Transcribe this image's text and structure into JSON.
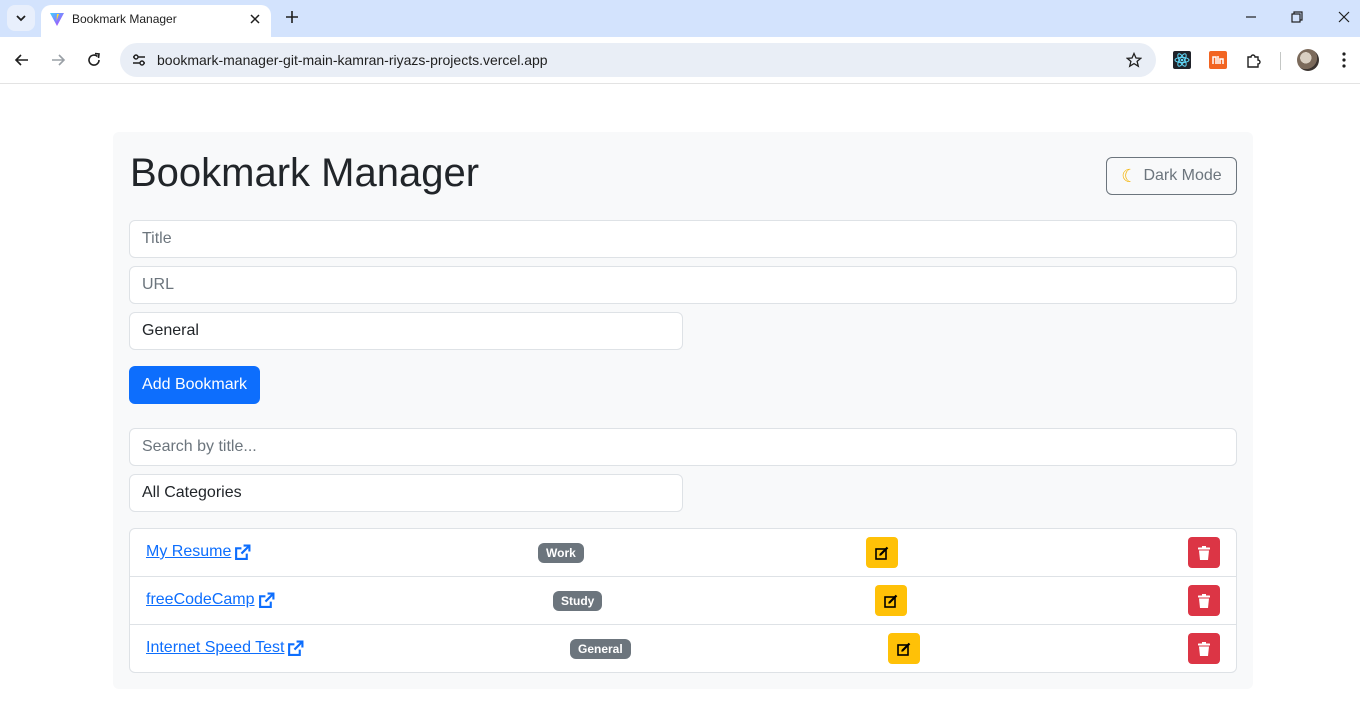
{
  "browser": {
    "tab_title": "Bookmark Manager",
    "url": "bookmark-manager-git-main-kamran-riyazs-projects.vercel.app"
  },
  "page": {
    "title": "Bookmark Manager",
    "dark_mode_label": "Dark Mode",
    "title_placeholder": "Title",
    "url_placeholder": "URL",
    "category_value": "General",
    "add_button": "Add Bookmark",
    "search_placeholder": "Search by title...",
    "filter_value": "All Categories"
  },
  "bookmarks": [
    {
      "title": "My Resume",
      "category": "Work"
    },
    {
      "title": "freeCodeCamp",
      "category": "Study"
    },
    {
      "title": "Internet Speed Test",
      "category": "General"
    }
  ],
  "colors": {
    "primary": "#0d6efd",
    "warning": "#ffc107",
    "danger": "#dc3545",
    "secondary": "#6c757d"
  }
}
